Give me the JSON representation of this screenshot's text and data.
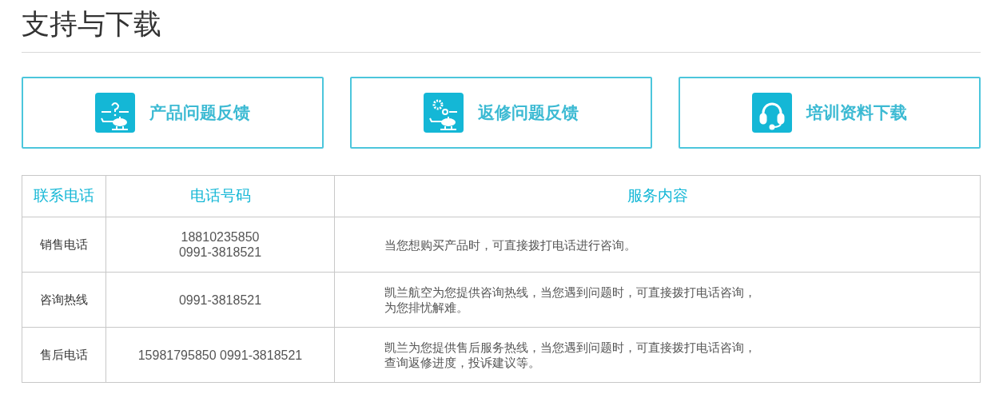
{
  "title": "支持与下载",
  "cards": [
    {
      "label": "产品问题反馈",
      "kind": "helicopter-question"
    },
    {
      "label": "返修问题反馈",
      "kind": "helicopter-gear"
    },
    {
      "label": "培训资料下载",
      "kind": "headset"
    }
  ],
  "table": {
    "columns": [
      "联系电话",
      "电话号码",
      "服务内容"
    ],
    "rows": [
      {
        "type": "销售电话",
        "phones": [
          "18810235850",
          "0991-3818521"
        ],
        "service": [
          "当您想购买产品时，可直接拨打电话进行咨询。"
        ]
      },
      {
        "type": "咨询热线",
        "phones": [
          "0991-3818521"
        ],
        "service": [
          "凯兰航空为您提供咨询热线，当您遇到问题时，可直接拨打电话咨询，",
          "为您排忧解难。"
        ]
      },
      {
        "type": "售后电话",
        "phones": [
          "15981795850 0991-3818521"
        ],
        "service": [
          "凯兰为您提供售后服务热线，当您遇到问题时，可直接拨打电话咨询，",
          "查询返修进度，投诉建议等。"
        ]
      }
    ]
  }
}
